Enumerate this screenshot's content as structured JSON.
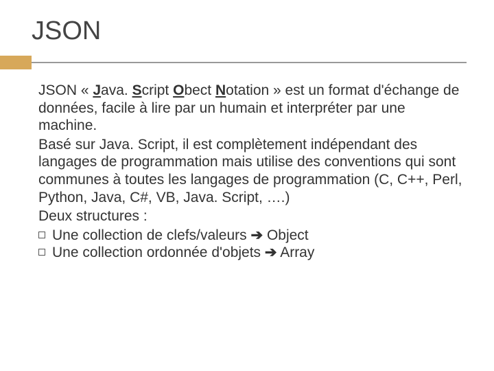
{
  "title": "JSON",
  "p1": {
    "pre": "JSON « ",
    "j": "J",
    "ava": "ava. ",
    "s": "S",
    "cript": "cript ",
    "o": "O",
    "bect": "bect ",
    "n": "N",
    "otation": "otation » est un format d'échange de données, facile à lire par un humain et interpréter par une machine."
  },
  "p2": "Basé sur Java. Script, il est complètement indépendant des langages de programmation mais utilise des conventions qui sont communes à toutes les langages de programmation (C, C++, Perl, Python, Java, C#, VB, Java. Script, ….)",
  "p3": "Deux structures :",
  "bullets": [
    {
      "text": "Une collection de clefs/valeurs",
      "arrow": "➔",
      "after": "Object"
    },
    {
      "text": "Une collection ordonnée d'objets ",
      "arrow": "➔",
      "after": "Array"
    }
  ]
}
